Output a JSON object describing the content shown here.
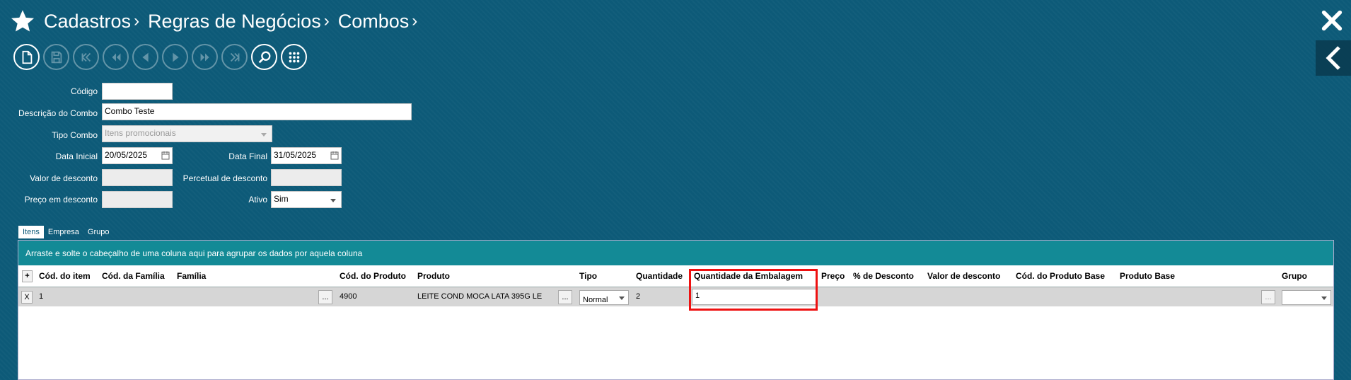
{
  "header": {
    "breadcrumb": [
      "Cadastros",
      "Regras de Negócios",
      "Combos"
    ],
    "icons": [
      "star-icon",
      "close-icon",
      "chevron-left-icon"
    ]
  },
  "toolbar": {
    "buttons": [
      "new-doc",
      "save",
      "first",
      "prev-page",
      "prev",
      "next",
      "next-page",
      "last",
      "search",
      "grid"
    ]
  },
  "form": {
    "codigo_label": "Código",
    "codigo_value": "",
    "descricao_label": "Descrição do Combo",
    "descricao_value": "Combo Teste",
    "tipo_label": "Tipo Combo",
    "tipo_value": "Itens promocionais",
    "data_inicial_label": "Data Inicial",
    "data_inicial_value": "20/05/2025",
    "data_final_label": "Data Final",
    "data_final_value": "31/05/2025",
    "valor_desconto_label": "Valor de desconto",
    "percentual_label": "Percetual de desconto",
    "preco_desconto_label": "Preço em desconto",
    "ativo_label": "Ativo",
    "ativo_value": "Sim"
  },
  "tabs": [
    "Itens",
    "Empresa",
    "Grupo"
  ],
  "grid": {
    "group_bar": "Arraste e solte o cabeçalho de uma coluna aqui para agrupar os dados por aquela coluna",
    "add_label": "+",
    "columns": {
      "cod_item": "Cód. do item",
      "cod_familia": "Cód. da Família",
      "familia": "Família",
      "cod_produto": "Cód. do Produto",
      "produto": "Produto",
      "tipo": "Tipo",
      "quantidade": "Quantidade",
      "qtd_embalagem": "Quantidade da Embalagem",
      "preco": "Preço",
      "pct_desconto": "% de Desconto",
      "valor_desconto": "Valor de desconto",
      "cod_produto_base": "Cód. do Produto Base",
      "produto_base": "Produto Base",
      "grupo": "Grupo"
    },
    "row": {
      "remove_label": "X",
      "cod_item": "1",
      "ellipsis": "...",
      "cod_produto": "4900",
      "produto": "LEITE COND MOCA LATA 395G LE",
      "tipo": "Normal",
      "quantidade": "2",
      "qtd_embalagem": "1",
      "grupo": ""
    }
  },
  "colors": {
    "background": "#0d5a78",
    "group_bar": "#138a96",
    "highlight": "#ee1111"
  }
}
